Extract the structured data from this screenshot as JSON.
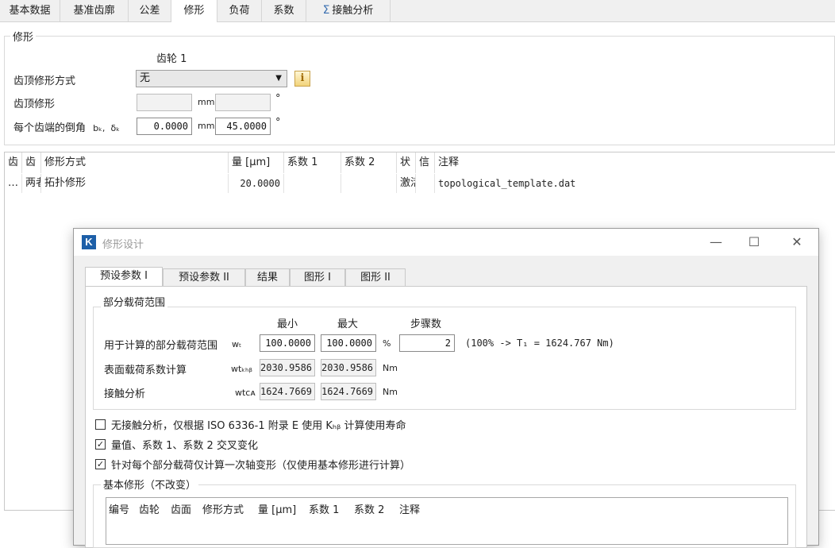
{
  "main_tabs": [
    "基本数据",
    "基准齿廓",
    "公差",
    "修形",
    "负荷",
    "系数",
    "接触分析"
  ],
  "active_tab_index": 3,
  "modification_group": {
    "title": "修形",
    "gear_header": "齿轮 1",
    "tip_mod_method_label": "齿顶修形方式",
    "tip_mod_method_value": "无",
    "tip_mod_label": "齿顶修形",
    "tip_mod_unit": "mm",
    "tip_mod_angle_unit": "°",
    "chamfer_label": "每个齿端的倒角",
    "chamfer_symbol_b": "bₖ,",
    "chamfer_symbol_d": "δₖ",
    "chamfer_value": "0.0000",
    "chamfer_unit": "mm",
    "chamfer_angle": "45.0000",
    "chamfer_angle_unit": "°"
  },
  "mod_table": {
    "columns": [
      "齿",
      "齿",
      "修形方式",
      "量 [μm]",
      "系数 1",
      "系数 2",
      "状",
      "信",
      "注释"
    ],
    "rows": [
      {
        "c0": "…",
        "c1": "两者",
        "c2": "拓扑修形",
        "c3": "20.0000",
        "c4": "",
        "c5": "",
        "c6": "激活",
        "c7": "",
        "c8": "topological_template.dat"
      }
    ]
  },
  "dialog": {
    "logo": "K",
    "title": "修形设计",
    "minimize": "—",
    "maximize": "☐",
    "close": "✕",
    "tabs": [
      "预设参数 I",
      "预设参数 II",
      "结果",
      "图形 I",
      "图形 II"
    ],
    "active_tab_index": 0,
    "partial_load": {
      "title": "部分载荷范围",
      "col_min": "最小",
      "col_max": "最大",
      "col_steps": "步骤数",
      "row1_label": "用于计算的部分载荷范围",
      "row1_symbol": "wₜ",
      "row1_min": "100.0000",
      "row1_max": "100.0000",
      "row1_unit": "%",
      "row1_steps": "2",
      "row1_note": "(100% -> T₁ = 1624.767 Nm)",
      "row2_label": "表面载荷系数计算",
      "row2_symbol": "wtₖₕᵦ",
      "row2_min": "2030.9586",
      "row2_max": "2030.9586",
      "row2_unit": "Nm",
      "row3_label": "接触分析",
      "row3_symbol": "wtᴄᴀ",
      "row3_min": "1624.7669",
      "row3_max": "1624.7669",
      "row3_unit": "Nm"
    },
    "options": [
      {
        "label": "无接触分析，仅根据 ISO 6336-1 附录 E 使用 Kₕᵦ 计算使用寿命",
        "checked": false
      },
      {
        "label": "量值、系数 1、系数 2 交叉变化",
        "checked": true
      },
      {
        "label": "针对每个部分载荷仅计算一次轴变形（仅使用基本修形进行计算）",
        "checked": true
      }
    ],
    "base_mod": {
      "title": "基本修形（不改变）",
      "columns": [
        "编号",
        "齿轮",
        "齿面",
        "修形方式",
        "量 [μm]",
        "系数 1",
        "系数 2",
        "注释"
      ]
    }
  }
}
